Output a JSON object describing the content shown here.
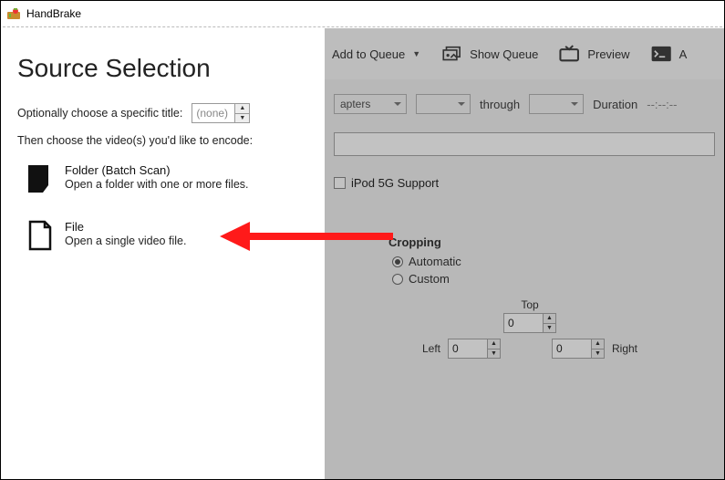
{
  "app": {
    "title": "HandBrake"
  },
  "source_panel": {
    "heading": "Source Selection",
    "title_label": "Optionally choose a specific title:",
    "title_value": "(none)",
    "choose_label": "Then choose the video(s) you'd like to encode:",
    "folder_title": "Folder (Batch Scan)",
    "folder_desc": "Open a folder with one or more files.",
    "file_title": "File",
    "file_desc": "Open a single video file."
  },
  "toolbar": {
    "add_queue": "Add to Queue",
    "show_queue": "Show Queue",
    "preview": "Preview",
    "activity": "A"
  },
  "main": {
    "chapters_label": "apters",
    "through": "through",
    "duration_label": "Duration",
    "duration_value": "--:--:--",
    "ipod_label": "iPod 5G Support"
  },
  "crop": {
    "label": "Cropping",
    "auto": "Automatic",
    "custom": "Custom",
    "top": "Top",
    "left": "Left",
    "right": "Right",
    "val_top": "0",
    "val_left": "0",
    "val_right": "0"
  }
}
